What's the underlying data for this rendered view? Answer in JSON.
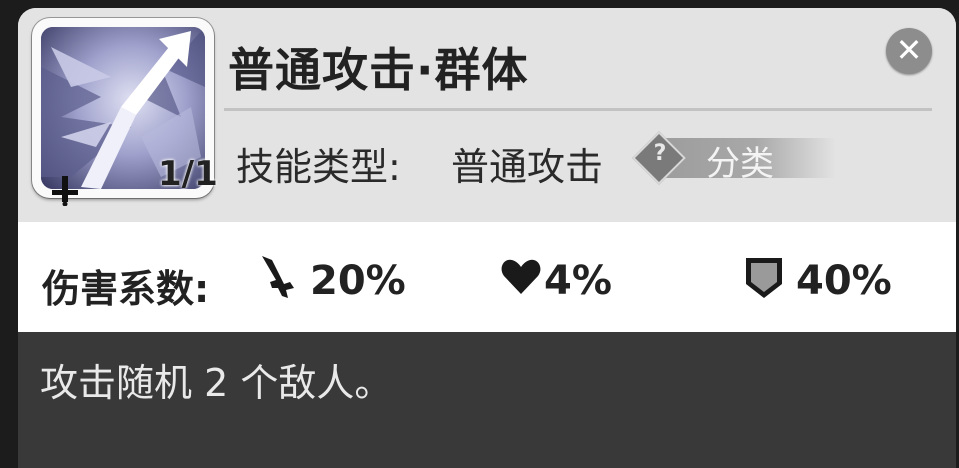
{
  "skill": {
    "title": "普通攻击·群体",
    "level": "1/1",
    "type_label": "技能类型:",
    "type_value": "普通攻击",
    "category_label": "分类",
    "category_help": "?",
    "close": "✕"
  },
  "stats": {
    "label": "伤害系数:",
    "attack": "20%",
    "hp": "4%",
    "defense": "40%"
  },
  "description": "攻击随机 2 个敌人。",
  "colors": {
    "panel": "#e3e3e3",
    "stats_bg": "#ffffff",
    "desc_bg": "#393939",
    "text_dark": "#222222",
    "text_light": "#e9e9e9"
  }
}
